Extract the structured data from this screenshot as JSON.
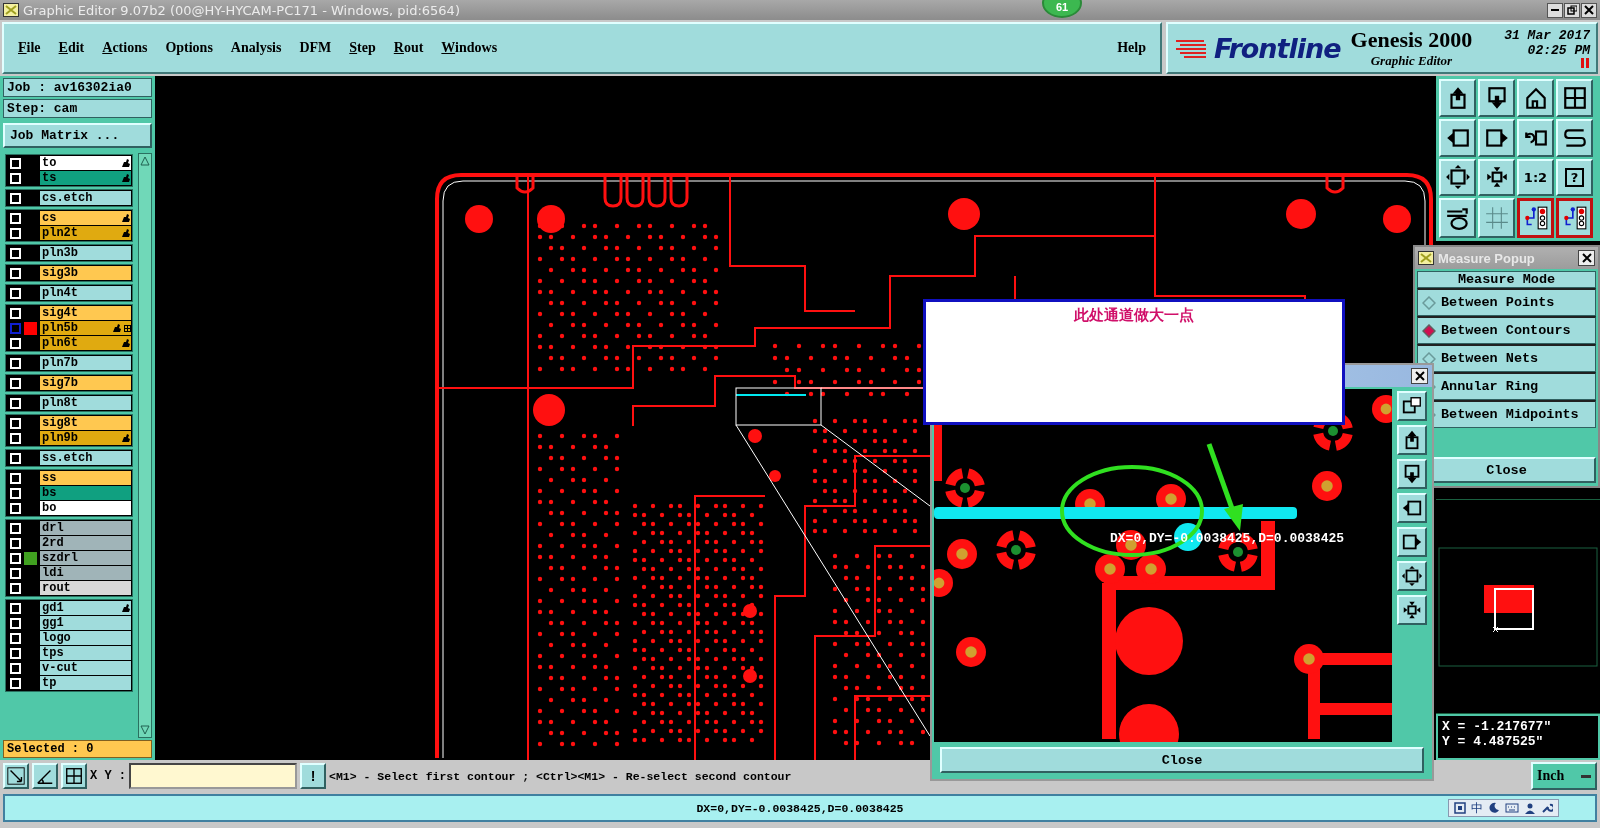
{
  "window": {
    "title": "Graphic Editor 9.07b2 (00@HY-HYCAM-PC171 - Windows, pid:6564)",
    "badge": "61"
  },
  "menu": {
    "items": [
      {
        "label": "File",
        "underlined": true
      },
      {
        "label": "Edit",
        "underlined": true
      },
      {
        "label": "Actions",
        "underlined": true
      },
      {
        "label": "Options",
        "underlined": false
      },
      {
        "label": "Analysis",
        "underlined": false
      },
      {
        "label": "DFM",
        "underlined": false
      },
      {
        "label": "Step",
        "underlined": true
      },
      {
        "label": "Rout",
        "underlined": true
      },
      {
        "label": "Windows",
        "underlined": true
      }
    ],
    "help": "Help"
  },
  "brand": {
    "logo": "Frontline",
    "product": "Genesis 2000",
    "subtitle": "Graphic Editor",
    "date": "31 Mar 2017",
    "time": "02:25 PM"
  },
  "job": {
    "job": "Job : av16302ia0",
    "step": "Step: cam",
    "matrix_button": "Job Matrix ..."
  },
  "layer_groups": [
    {
      "layers": [
        {
          "name": "to",
          "color": "#ffffff",
          "checked": false,
          "affected": true,
          "work": false
        },
        {
          "name": "ts",
          "color": "#10a080",
          "checked": false,
          "affected": true,
          "work": false
        }
      ]
    },
    {
      "layers": [
        {
          "name": "cs.etch",
          "color": "#a0dcdc",
          "checked": false,
          "affected": false,
          "work": false
        }
      ]
    },
    {
      "layers": [
        {
          "name": "cs",
          "color": "#ffc850",
          "checked": false,
          "affected": true,
          "work": false
        },
        {
          "name": "pln2t",
          "color": "#e0aa10",
          "checked": false,
          "affected": true,
          "work": false
        }
      ]
    },
    {
      "layers": [
        {
          "name": "pln3b",
          "color": "#a0dcdc",
          "checked": false,
          "affected": false,
          "work": false
        }
      ]
    },
    {
      "layers": [
        {
          "name": "sig3b",
          "color": "#ffc850",
          "checked": false,
          "affected": false,
          "work": false
        }
      ]
    },
    {
      "layers": [
        {
          "name": "pln4t",
          "color": "#a0dcdc",
          "checked": false,
          "affected": false,
          "work": false
        }
      ]
    },
    {
      "layers": [
        {
          "name": "sig4t",
          "color": "#ffc850",
          "checked": false,
          "affected": false,
          "work": false
        },
        {
          "name": "pln5b",
          "color": "#e0aa10",
          "checked": false,
          "affected": true,
          "work": true,
          "swatch": {
            "color": "#ff0000"
          }
        },
        {
          "name": "pln6t",
          "color": "#e0aa10",
          "checked": false,
          "affected": true,
          "work": false
        }
      ]
    },
    {
      "layers": [
        {
          "name": "pln7b",
          "color": "#a0dcdc",
          "checked": false,
          "affected": false,
          "work": false
        }
      ]
    },
    {
      "layers": [
        {
          "name": "sig7b",
          "color": "#ffc850",
          "checked": false,
          "affected": false,
          "work": false
        }
      ]
    },
    {
      "layers": [
        {
          "name": "pln8t",
          "color": "#a0dcdc",
          "checked": false,
          "affected": false,
          "work": false
        }
      ]
    },
    {
      "layers": [
        {
          "name": "sig8t",
          "color": "#ffc850",
          "checked": false,
          "affected": false,
          "work": false
        },
        {
          "name": "pln9b",
          "color": "#e0aa10",
          "checked": false,
          "affected": true,
          "work": false
        }
      ]
    },
    {
      "layers": [
        {
          "name": "ss.etch",
          "color": "#a0dcdc",
          "checked": false,
          "affected": false,
          "work": false
        }
      ]
    },
    {
      "layers": [
        {
          "name": "ss",
          "color": "#ffc850",
          "checked": false,
          "affected": false,
          "work": false
        },
        {
          "name": "bs",
          "color": "#10a080",
          "checked": false,
          "affected": false,
          "work": false
        },
        {
          "name": "bo",
          "color": "#ffffff",
          "checked": false,
          "affected": false,
          "work": false
        }
      ]
    },
    {
      "layers": [
        {
          "name": "drl",
          "color": "#a0b4b8",
          "checked": false,
          "affected": false,
          "work": false
        },
        {
          "name": "2rd",
          "color": "#a0b4b8",
          "checked": false,
          "affected": false,
          "work": false
        },
        {
          "name": "szdrl",
          "color": "#a0b4b8",
          "checked": false,
          "affected": false,
          "work": false,
          "swatch": {
            "color": "#40a020"
          }
        },
        {
          "name": "ldi",
          "color": "#a0b4b8",
          "checked": false,
          "affected": false,
          "work": false
        },
        {
          "name": "rout",
          "color": "#d8d8d8",
          "checked": false,
          "affected": false,
          "work": false
        }
      ]
    },
    {
      "layers": [
        {
          "name": "gd1",
          "color": "#a0dcdc",
          "checked": false,
          "affected": true,
          "work": false
        },
        {
          "name": "gg1",
          "color": "#a0dcdc",
          "checked": false,
          "affected": false,
          "work": false
        },
        {
          "name": "logo",
          "color": "#a0dcdc",
          "checked": false,
          "affected": false,
          "work": false
        },
        {
          "name": "tps",
          "color": "#a0dcdc",
          "checked": false,
          "affected": false,
          "work": false
        },
        {
          "name": "v-cut",
          "color": "#a0dcdc",
          "checked": false,
          "affected": false,
          "work": false
        },
        {
          "name": "tp",
          "color": "#a0dcdc",
          "checked": false,
          "affected": false,
          "work": false
        }
      ]
    }
  ],
  "selected_count": "Selected : 0",
  "toolbar": [
    {
      "on": false
    },
    {
      "on": false
    },
    {
      "on": false
    },
    {
      "on": false
    },
    {
      "on": false
    },
    {
      "on": false
    },
    {
      "on": false
    },
    {
      "on": false
    },
    {
      "on": false
    },
    {
      "on": false
    },
    {
      "label": "1:2",
      "on": false
    },
    {
      "label": "?",
      "on": false
    },
    {
      "on": false
    },
    {
      "on": false
    },
    {
      "on": true
    },
    {
      "on": true
    }
  ],
  "measure_popup": {
    "title": "Measure Popup",
    "heading": "Measure Mode",
    "modes": [
      {
        "label": "Between Points",
        "selected": false
      },
      {
        "label": "Between Contours",
        "selected": true
      },
      {
        "label": "Between Nets",
        "selected": false
      },
      {
        "label": "Annular Ring",
        "selected": false
      },
      {
        "label": "Between Midpoints",
        "selected": false
      }
    ],
    "close": "Close"
  },
  "annotation": {
    "text": "此处通道做大一点"
  },
  "zoom_window": {
    "measurement": "DX=0,DY=-0.0038425,D=0.0038425",
    "close": "Close"
  },
  "coordinates": {
    "x": "X = -1.217677\"",
    "y": "Y = 4.487525\""
  },
  "command_bar": {
    "label": "X Y :",
    "bang": "!",
    "prompt": "<M1> - Select first contour ; <Ctrl><M1> - Re-select second contour",
    "units": "Inch"
  },
  "status_bar": {
    "text": "DX=0,DY=-0.0038425,D=0.0038425",
    "ime": "中"
  }
}
